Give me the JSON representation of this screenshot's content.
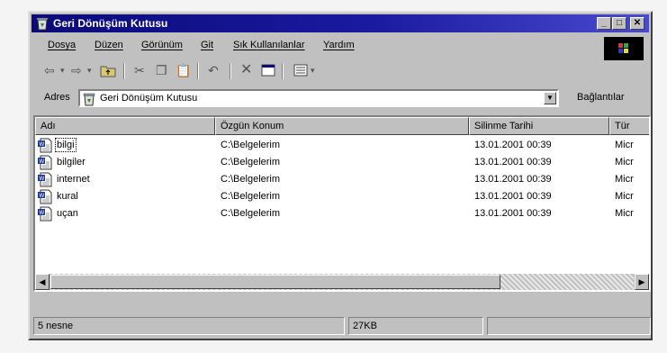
{
  "window": {
    "title": "Geri Dönüşüm Kutusu",
    "buttons": {
      "minimize": "_",
      "maximize": "□",
      "close": "✕"
    }
  },
  "menu": {
    "items": [
      "Dosya",
      "Düzen",
      "Görünüm",
      "Git",
      "Sık Kullanılanlar",
      "Yardım"
    ]
  },
  "toolbar": {
    "icons": [
      "back-icon",
      "forward-icon",
      "up-folder-icon",
      "cut-icon",
      "copy-icon",
      "paste-icon",
      "undo-icon",
      "delete-icon",
      "properties-icon",
      "views-icon"
    ]
  },
  "address": {
    "label": "Adres",
    "value": "Geri Dönüşüm Kutusu",
    "links_label": "Bağlantılar"
  },
  "list": {
    "columns": [
      "Adı",
      "Özgün Konum",
      "Silinme Tarihi",
      "Tür"
    ],
    "rows": [
      {
        "name": "bilgi",
        "location": "C:\\Belgelerim",
        "date": "13.01.2001 00:39",
        "type": "Micr",
        "selected": true
      },
      {
        "name": "bilgiler",
        "location": "C:\\Belgelerim",
        "date": "13.01.2001 00:39",
        "type": "Micr",
        "selected": false
      },
      {
        "name": "internet",
        "location": "C:\\Belgelerim",
        "date": "13.01.2001 00:39",
        "type": "Micr",
        "selected": false
      },
      {
        "name": "kural",
        "location": "C:\\Belgelerim",
        "date": "13.01.2001 00:39",
        "type": "Micr",
        "selected": false
      },
      {
        "name": "uçan",
        "location": "C:\\Belgelerim",
        "date": "13.01.2001 00:39",
        "type": "Micr",
        "selected": false
      }
    ]
  },
  "status": {
    "count": "5 nesne",
    "size": "27KB"
  },
  "colors": {
    "title_bar": "#0a0a7a",
    "chrome": "#c0c0c0"
  }
}
